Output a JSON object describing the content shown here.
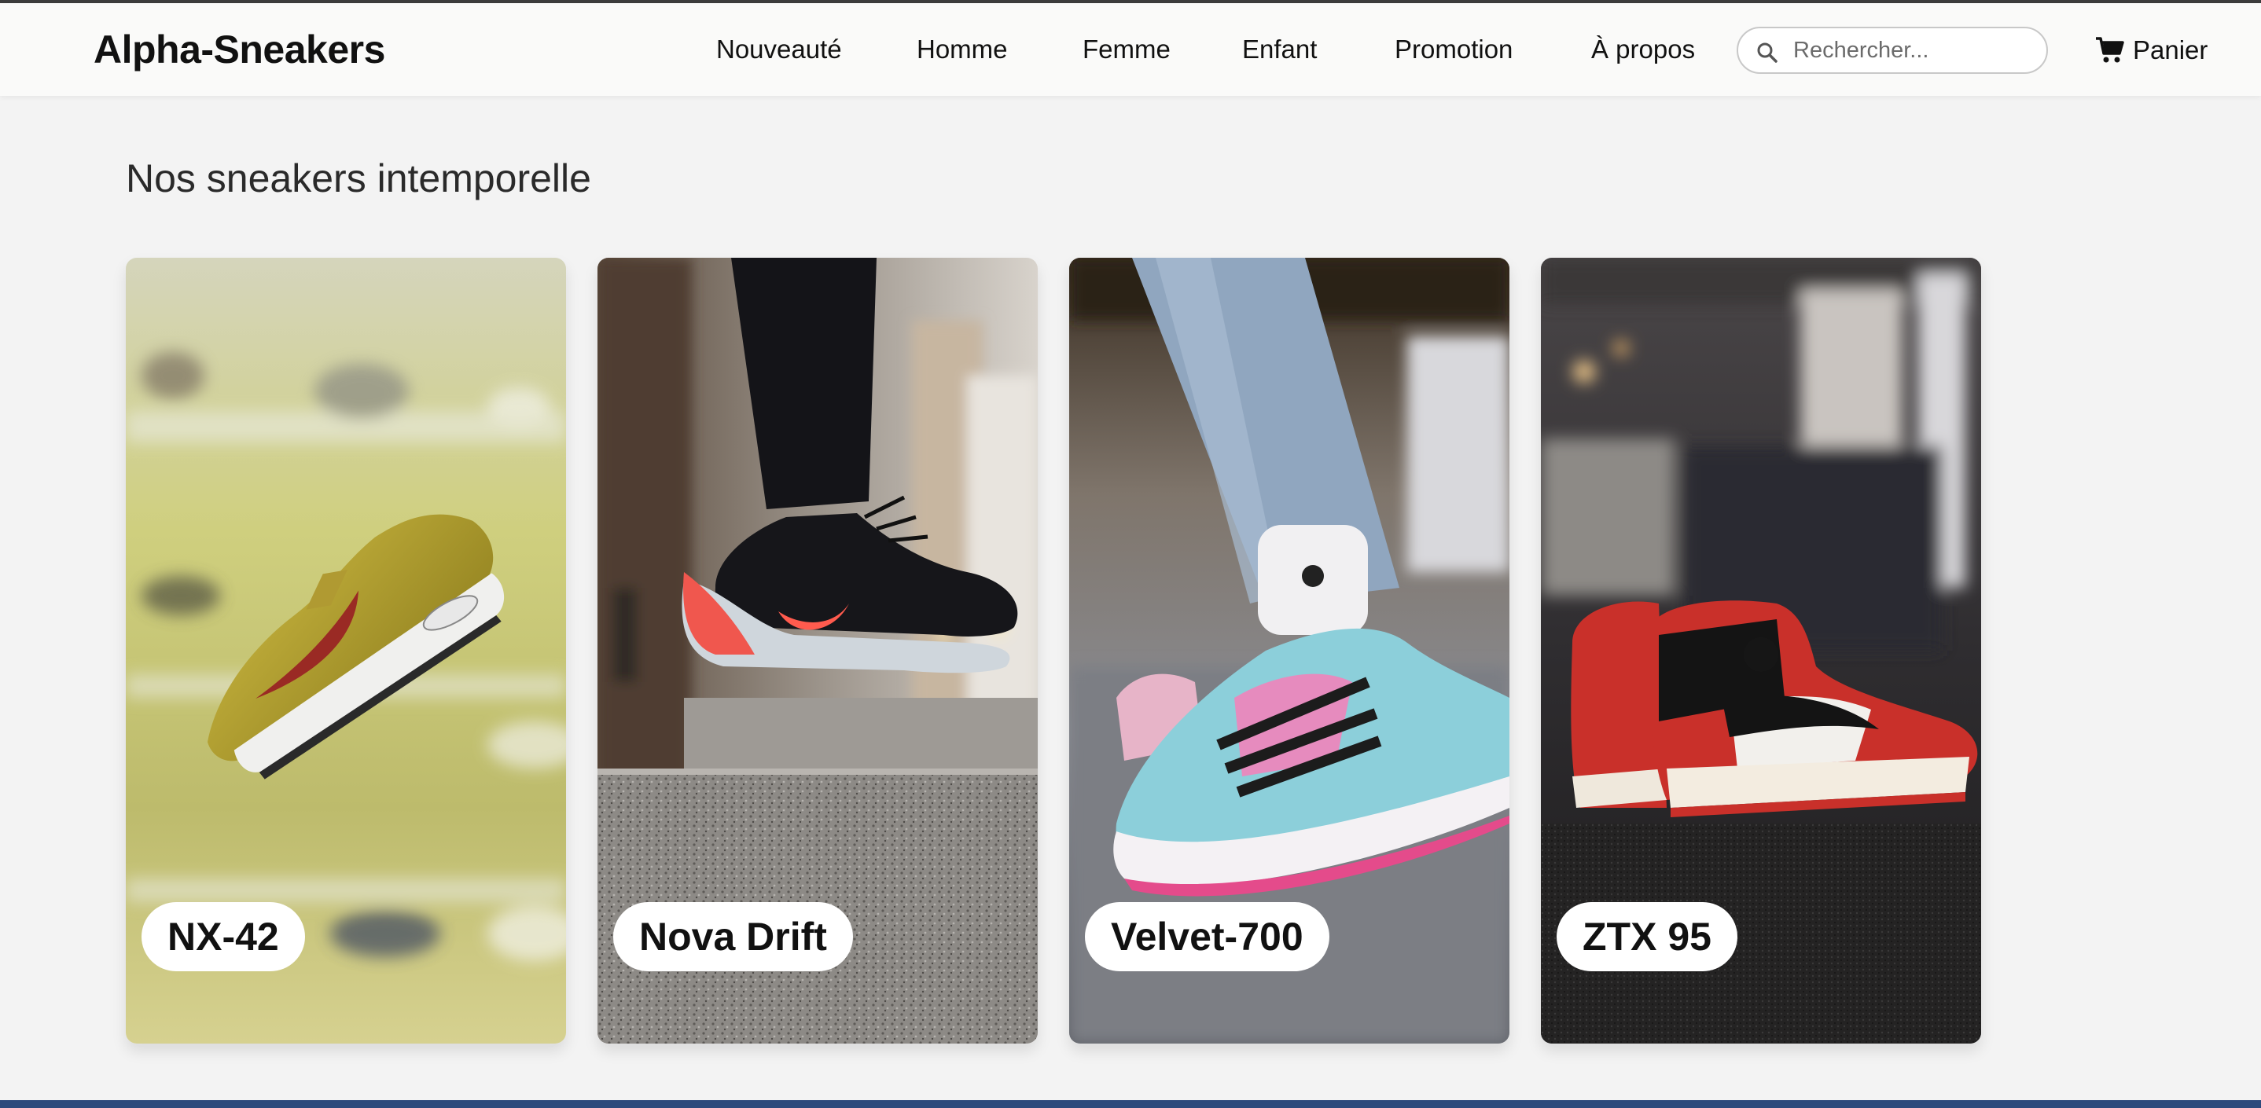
{
  "header": {
    "brand": "Alpha-Sneakers",
    "nav": [
      "Nouveauté",
      "Homme",
      "Femme",
      "Enfant",
      "Promotion",
      "À propos"
    ],
    "search_placeholder": "Rechercher...",
    "cart_label": "Panier",
    "search_icon": "search-icon",
    "cart_icon": "shopping-cart-icon"
  },
  "main": {
    "section_title": "Nos sneakers intemporelle",
    "products": [
      {
        "name": "NX-42"
      },
      {
        "name": "Nova Drift"
      },
      {
        "name": "Velvet-700"
      },
      {
        "name": "ZTX 95"
      }
    ]
  },
  "colors": {
    "page_background": "#f3f3f3",
    "navbar_background": "#fafaf9",
    "label_pill": "#ffffff",
    "text": "#111111"
  }
}
